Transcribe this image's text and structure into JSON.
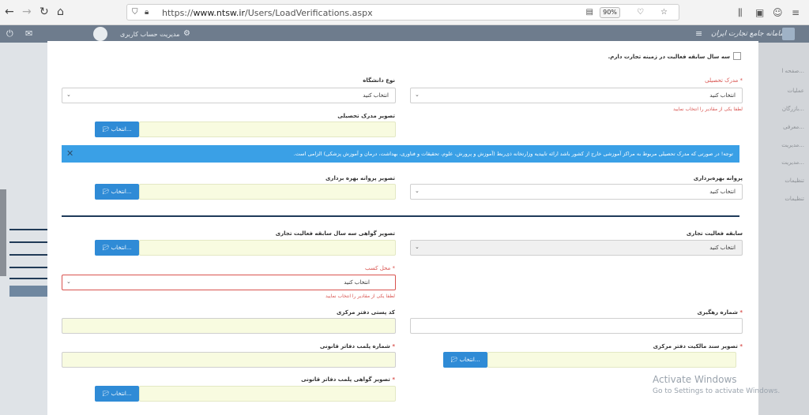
{
  "browser": {
    "url_scheme": "https://",
    "url_host": "www.ntsw.ir",
    "url_path": "/Users/LoadVerifications.aspx",
    "zoom": "90%"
  },
  "app": {
    "brand": "سامانه جامع تجارت ایران",
    "account_label": "مدیریت حساب کاربری"
  },
  "sidebar": {
    "items": [
      "صفحه ا...",
      "عملیات",
      "بازرگان...",
      "معرفی...",
      "مدیریت...",
      "مدیریت...",
      "تنظیمات",
      "تنظیمات"
    ]
  },
  "form": {
    "experience_checkbox": "سه سال سابقه فعالیت در زمینه تجارت دارم.",
    "degree_label": "مدرک تحصیلی",
    "degree_value": "انتخاب کنید",
    "degree_error": "لطفا یکی از مقادیر را انتخاب نمایید",
    "university_label": "نوع دانشگاه",
    "university_value": "انتخاب کنید",
    "degree_image_label": "تصویر مدرک تحصیلی",
    "choose_button": "انتخاب...",
    "notice": "توجه! در صورتی که مدرک تحصیلی مربوط به مراکز آموزشی خارج از کشور باشد ارائه تاییدیه وزارتخانه ذی‌ربط (آموزش و پرورش، علوم، تحقیقات و فناوری، بهداشت، درمان و آموزش پزشکی) الزامی است.",
    "license_label": "پروانه بهره‌برداری",
    "license_value": "انتخاب کنید",
    "license_image_label": "تصویر پروانه بهره برداری",
    "trade_history_label": "سابقه فعالیت تجاری",
    "trade_history_value": "انتخاب کنید",
    "trade_cert_label": "تصویر گواهی سه سال سابقه فعالیت تجاری",
    "workplace_label": "محل کسب",
    "workplace_value": "انتخاب کنید",
    "workplace_error": "لطفا یکی از مقادیر را انتخاب نمایید",
    "tracking_label": "شماره رهگیری",
    "postal_label": "کد پستی دفتر مرکزی",
    "ownership_label": "تصویر سند مالکیت دفتر مرکزی",
    "legal_plate_label": "شماره پلمب دفاتر قانونی",
    "legal_cert_label": "تصویر گواهی پلمب دفاتر قانونی"
  },
  "watermark": {
    "title": "Activate Windows",
    "subtitle": "Go to Settings to activate Windows."
  }
}
